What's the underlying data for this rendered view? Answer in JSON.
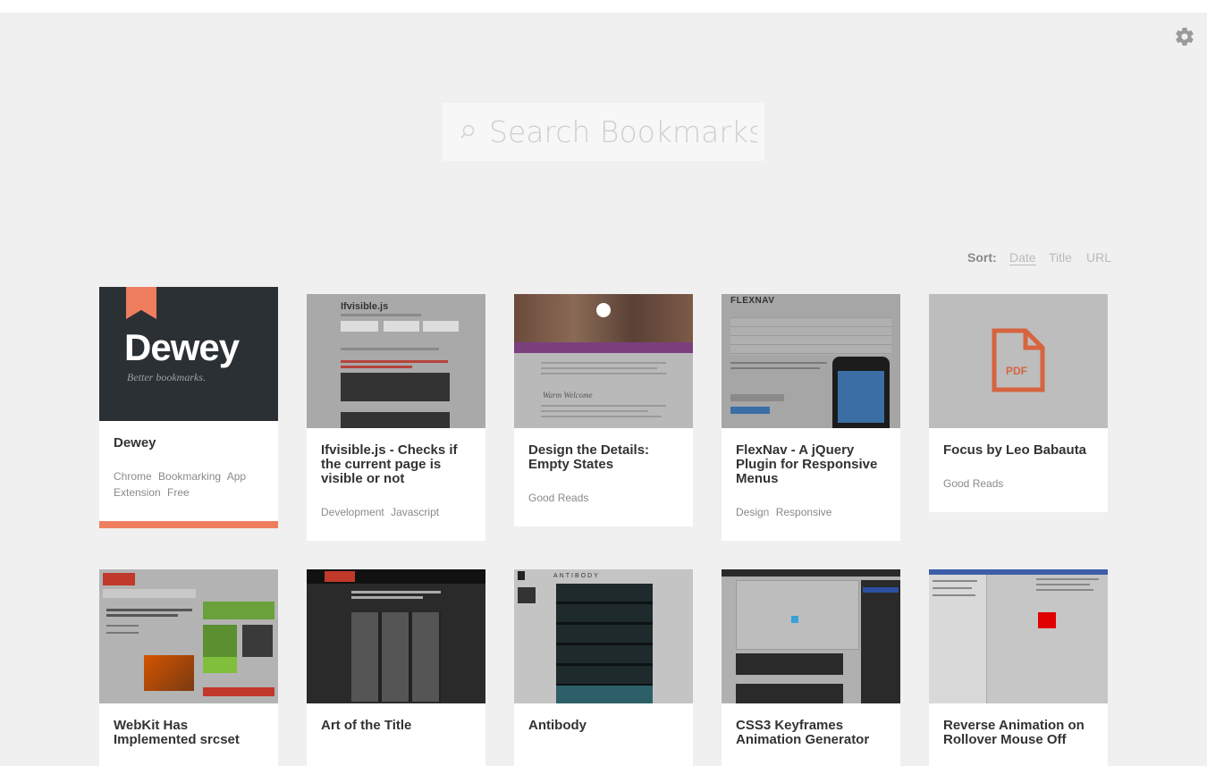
{
  "search": {
    "placeholder": "Search Bookmarks"
  },
  "sort": {
    "label": "Sort:",
    "options": [
      "Date",
      "Title",
      "URL"
    ],
    "selected": "Date"
  },
  "settings_icon": "gear-icon",
  "accent_color": "#ef7e5e",
  "cards": [
    {
      "title": "Dewey",
      "tags": [
        "Chrome",
        "Bookmarking",
        "App",
        "Extension",
        "Free"
      ],
      "thumb_text": "Dewey",
      "thumb_sub": "Better bookmarks."
    },
    {
      "title": "Ifvisible.js - Checks if the current page is visible or not",
      "tags": [
        "Development",
        "Javascript"
      ],
      "thumb_text": "Ifvisible.js"
    },
    {
      "title": "Design the Details: Empty States",
      "tags": [
        "Good Reads"
      ],
      "thumb_text": "Warm Welcome"
    },
    {
      "title": "FlexNav - A jQuery Plugin for Responsive Menus",
      "tags": [
        "Design",
        "Responsive"
      ],
      "thumb_text": "FLEXNAV"
    },
    {
      "title": "Focus by Leo Babauta",
      "tags": [
        "Good Reads"
      ],
      "thumb_text": "PDF"
    },
    {
      "title": "WebKit Has Implemented srcset",
      "tags": []
    },
    {
      "title": "Art of the Title",
      "tags": []
    },
    {
      "title": "Antibody",
      "tags": [],
      "thumb_text": "ANTIBODY"
    },
    {
      "title": "CSS3 Keyframes Animation Generator",
      "tags": []
    },
    {
      "title": "Reverse Animation on Rollover Mouse Off",
      "tags": []
    }
  ]
}
